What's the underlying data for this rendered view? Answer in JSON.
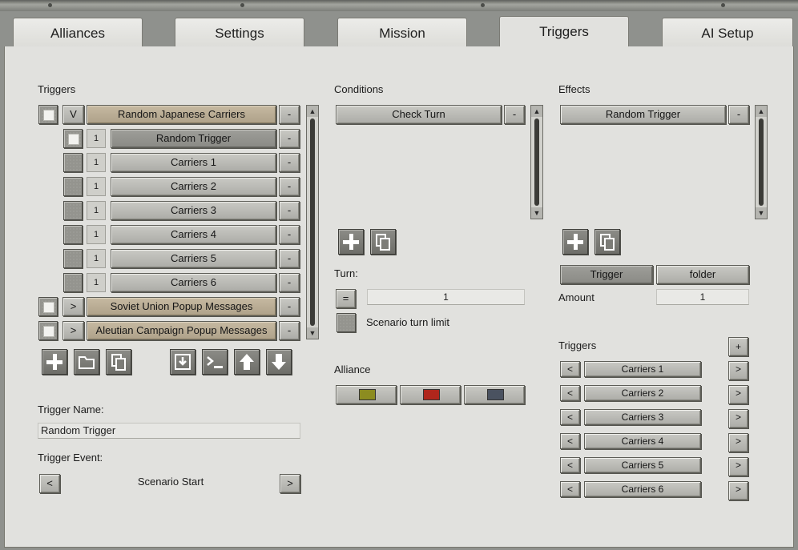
{
  "tabs": [
    "Alliances",
    "Settings",
    "Mission",
    "Triggers",
    "AI Setup"
  ],
  "active_tab": "Triggers",
  "triggers_panel": {
    "heading": "Triggers",
    "rows": [
      {
        "label": "Random Japanese Carriers",
        "prefix": "V",
        "type": "folder",
        "checked": true
      },
      {
        "label": "Random Trigger",
        "prefix": "1",
        "type": "child",
        "checked": true
      },
      {
        "label": "Carriers 1",
        "prefix": "1",
        "type": "child",
        "checked": false
      },
      {
        "label": "Carriers 2",
        "prefix": "1",
        "type": "child",
        "checked": false
      },
      {
        "label": "Carriers 3",
        "prefix": "1",
        "type": "child",
        "checked": false
      },
      {
        "label": "Carriers 4",
        "prefix": "1",
        "type": "child",
        "checked": false
      },
      {
        "label": "Carriers 5",
        "prefix": "1",
        "type": "child",
        "checked": false
      },
      {
        "label": "Carriers 6",
        "prefix": "1",
        "type": "child",
        "checked": false
      },
      {
        "label": "Soviet Union Popup Messages",
        "prefix": ">",
        "type": "folder",
        "checked": true
      },
      {
        "label": "Aleutian Campaign Popup Messages",
        "prefix": ">",
        "type": "folder",
        "checked": true
      }
    ],
    "remove_label": "-",
    "trigger_name_label": "Trigger Name:",
    "trigger_name_value": "Random Trigger",
    "trigger_event_label": "Trigger Event:",
    "trigger_event_value": "Scenario Start",
    "prev_label": "<",
    "next_label": ">"
  },
  "conditions": {
    "heading": "Conditions",
    "items": [
      "Check Turn"
    ],
    "remove_label": "-",
    "turn_label": "Turn:",
    "turn_operator": "=",
    "turn_value": "1",
    "limit_label": "Scenario turn limit",
    "alliance_label": "Alliance",
    "alliance_colors": [
      "#8c8c20",
      "#b0261c",
      "#4a5260"
    ]
  },
  "effects": {
    "heading": "Effects",
    "items": [
      "Random Trigger"
    ],
    "remove_label": "-",
    "mode_buttons": [
      "Trigger",
      "folder"
    ],
    "amount_label": "Amount",
    "amount_value": "1",
    "triggers_heading": "Triggers",
    "add_label": "+",
    "trigger_list": [
      "Carriers 1",
      "Carriers 2",
      "Carriers 3",
      "Carriers 4",
      "Carriers 5",
      "Carriers 6"
    ],
    "row_prev": "<",
    "row_next": ">"
  }
}
